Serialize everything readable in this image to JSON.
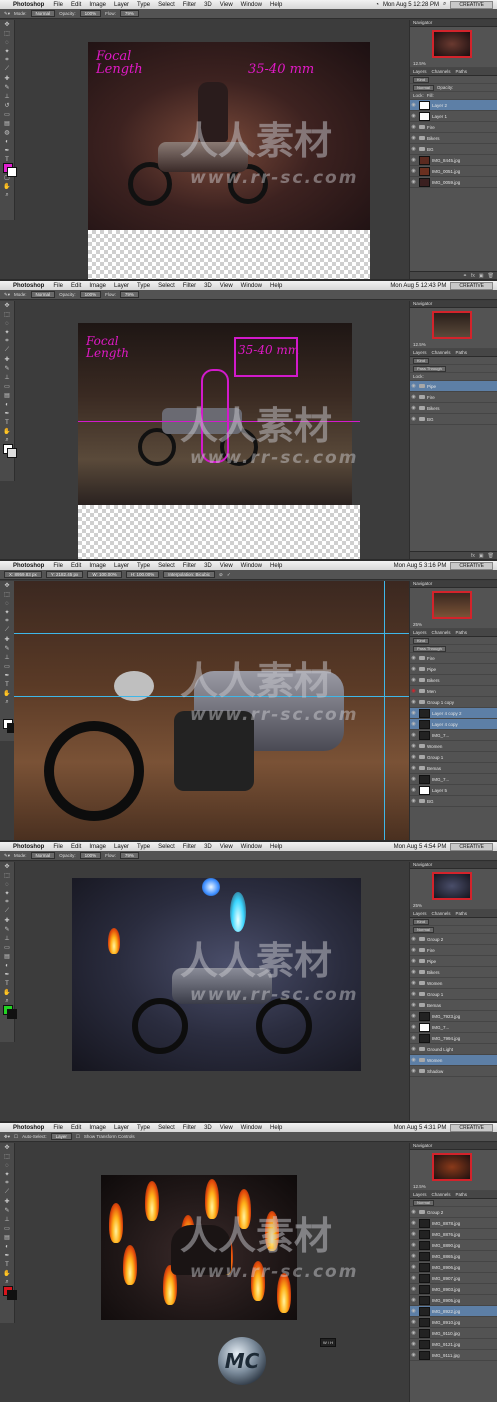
{
  "menu": {
    "app": "Photoshop",
    "items": [
      "File",
      "Edit",
      "Image",
      "Layer",
      "Type",
      "Select",
      "Filter",
      "3D",
      "View",
      "Window",
      "Help"
    ],
    "workspace": "CREATIVE"
  },
  "screens": [
    {
      "clock": "Mon Aug 5  12:28 PM",
      "opacity": "100%",
      "flow": "79%",
      "mode": "Normal",
      "zoom": "12.5%",
      "annotation_focal": "Focal Length",
      "annotation_mm": "35-40 mm",
      "layers": [
        "Layer 2",
        "Layer 1",
        "Fire",
        "Bikers",
        "BG",
        "IMG_8445.jpg",
        "IMG_0051.jpg",
        "IMG_0059.jpg"
      ]
    },
    {
      "clock": "Mon Aug 5  12:43 PM",
      "opacity": "100%",
      "flow": "79%",
      "mode": "Normal",
      "zoom": "12.5%",
      "annotation_focal": "Focal Length",
      "annotation_mm": "35-40 mm",
      "layers": [
        "Pipe",
        "Fire",
        "Bikers",
        "BG"
      ]
    },
    {
      "clock": "Mon Aug 5  3:16 PM",
      "opt_x": "X: 8959.83 px",
      "opt_y": "Y: 2182.45 px",
      "opt_w": "W: 100.00%",
      "opt_h": "H: 100.00%",
      "opt_interp": "Interpolation: Bicubic",
      "zoom": "25%",
      "layers": [
        "Fire",
        "Pipe",
        "Bikers",
        "Men",
        "Group 1 copy",
        "Layer 4 copy 2",
        "Layer 4 copy",
        "IMG_7...",
        "Women",
        "Group 1",
        "Bemas",
        "IMG_7...",
        "Layer 5",
        "BG"
      ]
    },
    {
      "clock": "Mon Aug 5  4:54 PM",
      "opacity": "100%",
      "flow": "79%",
      "mode": "Normal",
      "zoom": "25%",
      "layers": [
        "Group 2",
        "Fire",
        "Pipe",
        "Bikers",
        "Women",
        "Group 1",
        "Bemas",
        "IMG_7923.jpg",
        "IMG_7...",
        "IMG_7994.jpg",
        "Ground Light",
        "Women",
        "Shadow"
      ]
    },
    {
      "clock": "Mon Aug 5  4:31 PM",
      "opt_autoselect": "Auto-Select:",
      "opt_layer": "Layer",
      "opt_transform": "Show Transform Controls",
      "zoom": "12.5%",
      "layers": [
        "Group 2",
        "IMG_8878.jpg",
        "IMG_8876.jpg",
        "IMG_8890.jpg",
        "IMG_8865.jpg",
        "IMG_8906.jpg",
        "IMG_8907.jpg",
        "IMG_8903.jpg",
        "IMG_8905.jpg",
        "IMG_8922.jpg",
        "IMG_8910.jpg",
        "IMG_9110.jpg",
        "IMG_9121.jpg",
        "IMG_9111.jpg"
      ]
    }
  ],
  "panels": {
    "navigator": "Navigator",
    "tabs": [
      "Layers",
      "Channels",
      "Paths"
    ],
    "kind": "Kind",
    "blend": "Normal",
    "pass_through": "Pass Through",
    "opacity_label": "Opacity:",
    "fill_label": "Fill:",
    "lock_label": "Lock:"
  },
  "watermark": {
    "text": "人人素材",
    "url": "www.rr-sc.com"
  },
  "colors": {
    "accent": "#d3232b",
    "selection": "#5d7fa6",
    "annotation": "#e019c6",
    "guide": "#3fb7e8"
  }
}
